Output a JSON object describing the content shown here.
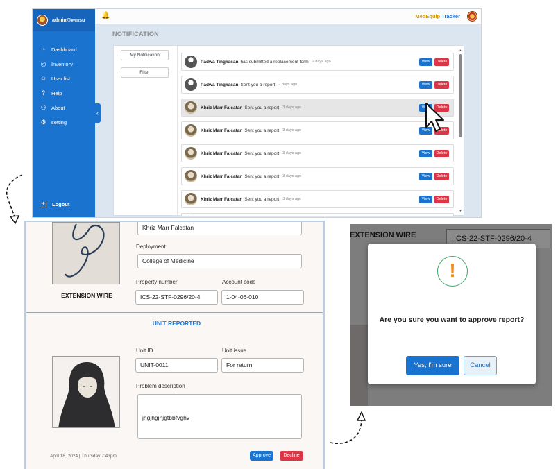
{
  "app": {
    "user": "admin@wmsu",
    "brand_part1": "MedEquip",
    "brand_part2": "Tracker",
    "page_title": "NOTIFICATION",
    "sidebar": [
      {
        "label": "Dashboard",
        "icon": "pie-chart-icon"
      },
      {
        "label": "Inventory",
        "icon": "inventory-icon"
      },
      {
        "label": "User list",
        "icon": "user-icon"
      },
      {
        "label": "Help",
        "icon": "help-icon"
      },
      {
        "label": "About",
        "icon": "people-icon"
      },
      {
        "label": "setting",
        "icon": "gear-icon"
      }
    ],
    "logout": "Logout",
    "filters": {
      "my_notification": "My Notification",
      "filter": "Filter"
    },
    "buttons": {
      "view": "View",
      "delete": "Delete"
    },
    "notifications": [
      {
        "name": "Padwa Tingkasan",
        "message": "has submitted a replacement form",
        "time": "2 days ago"
      },
      {
        "name": "Padwa Tingkasan",
        "message": "Sent you a report",
        "time": "2 days ago"
      },
      {
        "name": "Khriz Marr Falcatan",
        "message": "Sent you a report",
        "time": "3 days ago"
      },
      {
        "name": "Khriz Marr Falcatan",
        "message": "Sent you a report",
        "time": "3 days ago"
      },
      {
        "name": "Khriz Marr Falcatan",
        "message": "Sent you a report",
        "time": "3 days ago"
      },
      {
        "name": "Khriz Marr Falcatan",
        "message": "Sent you a report",
        "time": "3 days ago"
      },
      {
        "name": "Khriz Marr Falcatan",
        "message": "Sent you a report",
        "time": "3 days ago"
      }
    ]
  },
  "detail": {
    "reporter_name": "Khriz Marr Falcatan",
    "deployment_label": "Deployment",
    "deployment": "College of Medicine",
    "property_number_label": "Property number",
    "property_number": "ICS-22-STF-0296/20-4",
    "account_code_label": "Account code",
    "account_code": "1-04-06-010",
    "item_name": "EXTENSION WIRE",
    "section_title": "UNIT REPORTED",
    "unit_id_label": "Unit ID",
    "unit_id": "UNIT-0011",
    "unit_issue_label": "Unit issue",
    "unit_issue": "For return",
    "problem_label": "Problem description",
    "problem": "jhgjhgjhjgtbbfvghv",
    "datetime": "April 18, 2024 | Thursday 7:43pm",
    "approve": "Approve",
    "decline": "Decline"
  },
  "confirm": {
    "bg_title": "EXTENSION WIRE",
    "bg_field": "ICS-22-STF-0296/20-4",
    "icon": "!",
    "question": "Are you sure you want to approve report?",
    "yes": "Yes, I'm sure",
    "cancel": "Cancel"
  },
  "colors": {
    "primary": "#1b73d0",
    "danger": "#dc3545",
    "brand_gold": "#d79a00"
  }
}
